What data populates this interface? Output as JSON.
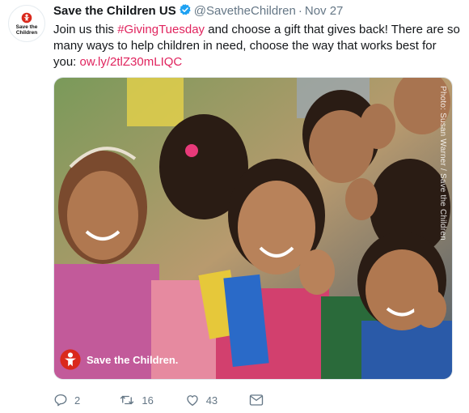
{
  "account": {
    "display_name": "Save the Children US",
    "handle": "@SavetheChildren",
    "separator": "·",
    "date": "Nov 27",
    "avatar_text": "Save the Children"
  },
  "tweet": {
    "text_before": "Join us this ",
    "hashtag": "#GivingTuesday",
    "text_after": " and choose a gift that gives back! There are so many ways to help children in need, choose the way that works best for you: ",
    "link": "ow.ly/2tlZ30mLIQC"
  },
  "media": {
    "photo_credit": "Photo: Susan Warner / Save the Children",
    "logo_text": "Save the Children."
  },
  "actions": {
    "reply_count": "2",
    "retweet_count": "16",
    "like_count": "43"
  },
  "colors": {
    "brand_red": "#e0245e",
    "secondary_text": "#657786",
    "verified_blue": "#1da1f2",
    "save_the_children_red": "#da291c"
  },
  "icons": [
    "reply-icon",
    "retweet-icon",
    "like-icon",
    "message-icon",
    "verified-icon",
    "save-the-children-logo-icon"
  ]
}
